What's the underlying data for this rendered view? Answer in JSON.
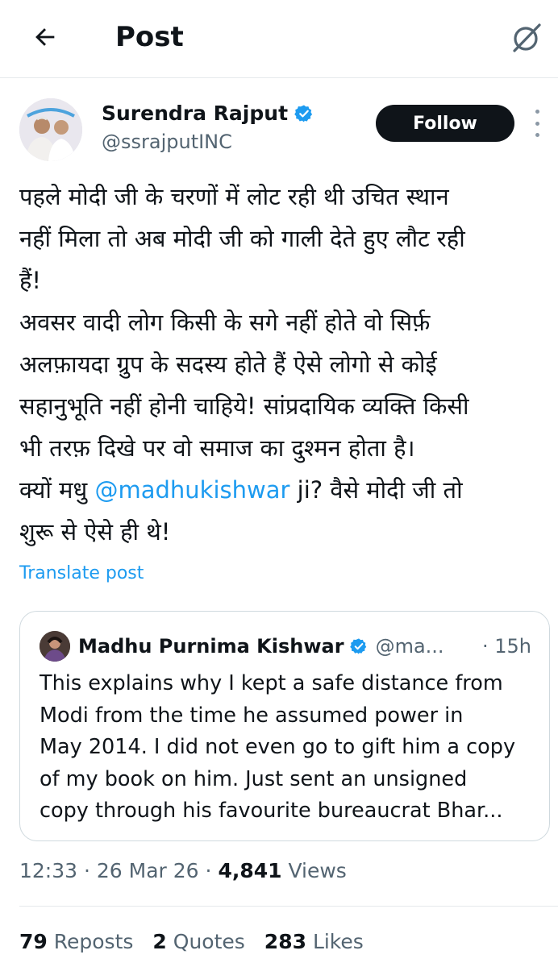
{
  "header": {
    "title": "Post",
    "back_icon": "arrow-left-icon",
    "grok_icon": "grok-icon"
  },
  "author": {
    "name": "Surendra Rajput",
    "handle": "@ssrajputINC",
    "verified": true,
    "follow_label": "Follow"
  },
  "post": {
    "lines": [
      "पहले मोदी जी के चरणों में लोट रही थी उचित स्थान",
      "नहीं मिला तो अब मोदी जी को गाली देते हुए लौट रही",
      "हैं!",
      "अवसर वादी लोग किसी के सगे नहीं होते वो सिर्फ़",
      "अलफ़ायदा ग्रुप के सदस्य होते हैं ऐसे लोगो से कोई",
      "सहानुभूति नहीं होनी चाहिये! सांप्रदायिक व्यक्ति किसी",
      "भी तरफ़ दिखे पर वो समाज का दुश्मन होता है।"
    ],
    "mention_line_prefix": "क्यों मधु ",
    "mention": "@madhukishwar",
    "mention_line_suffix": " ji? वैसे मोदी जी तो",
    "last_line": "शुरू से ऐसे ही थे!",
    "translate_label": "Translate post"
  },
  "quote": {
    "name": "Madhu Purnima Kishwar",
    "handle": "@ma...",
    "time": "· 15h",
    "verified": true,
    "lines": [
      "This explains why I kept a safe distance from",
      "Modi from the time he assumed power in",
      "May 2014. I did not even go to gift him a copy",
      "of my book on him. Just sent an unsigned",
      "copy through his favourite bureaucrat Bhar..."
    ]
  },
  "meta": {
    "time": "12:33",
    "date": "26 Mar 26",
    "views_count": "4,841",
    "views_label": "Views"
  },
  "stats": {
    "reposts_count": "79",
    "reposts_label": "Reposts",
    "quotes_count": "2",
    "quotes_label": "Quotes",
    "likes_count": "283",
    "likes_label": "Likes"
  },
  "colors": {
    "accent": "#1d9bf0",
    "text": "#0f1419",
    "secondary": "#536471",
    "border": "#cfd9de"
  }
}
